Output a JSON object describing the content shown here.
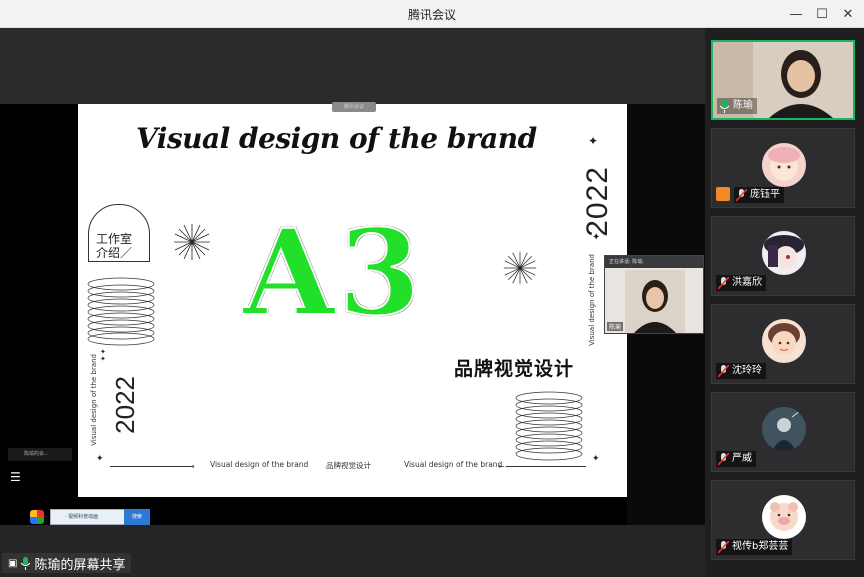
{
  "window": {
    "title": "腾讯会议"
  },
  "share": {
    "presenter_label": "陈瑜的屏幕共享",
    "sharing_pill": "腾讯会议"
  },
  "slide": {
    "title": "Visual design of the brand",
    "year": "2022",
    "vertical_caption": "Visual design of the brand",
    "studio_badge_line1": "工作室",
    "studio_badge_line2": "介绍／",
    "big_code": "A3",
    "brand_cn": "品牌视觉设计",
    "footer": {
      "item1": "Visual design of the brand",
      "item2": "品牌视觉设计",
      "item3": "Visual design of the brand"
    }
  },
  "float_video": {
    "header": "正在讲话: 陈瑜;",
    "name": "陈瑜"
  },
  "overlay": {
    "chat_mini": "陈瑜的会...",
    "taskbar_tab": "· 视频科普动画",
    "taskbar_blue": "搜索"
  },
  "participants": [
    {
      "name": "陈瑜",
      "active": true,
      "avatar": "video"
    },
    {
      "name": "庞钰平",
      "active": false,
      "avatar": "cartoon-pink",
      "host": true
    },
    {
      "name": "洪嘉欣",
      "active": false,
      "avatar": "anime-purple"
    },
    {
      "name": "沈玲玲",
      "active": false,
      "avatar": "photo-girl"
    },
    {
      "name": "严威",
      "active": false,
      "avatar": "dark-figure"
    },
    {
      "name": "视传b郑芸芸",
      "active": false,
      "avatar": "cartoon-pig"
    }
  ],
  "colors": {
    "accent_green": "#1bb55c",
    "a3_green": "#22e02a"
  }
}
